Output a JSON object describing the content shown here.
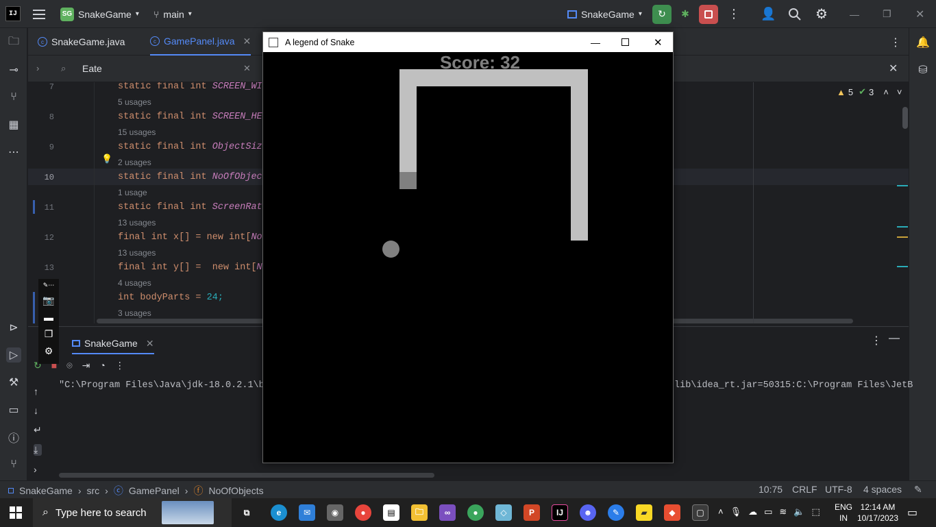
{
  "ide": {
    "project_name": "SnakeGame",
    "project_badge": "SG",
    "branch": "main",
    "run_config": "SnakeGame",
    "tabs": [
      {
        "label": "SnakeGame.java",
        "active": false
      },
      {
        "label": "GamePanel.java",
        "active": true
      }
    ],
    "search_query": "Eate",
    "inspections": {
      "warnings": "5",
      "ok": "3"
    },
    "code": [
      {
        "line": "7",
        "code": "static final int ",
        "ident": "SCREEN_WI",
        "usage": "5 usages"
      },
      {
        "line": "8",
        "code": "static final int ",
        "ident": "SCREEN_HE",
        "usage": "15 usages"
      },
      {
        "line": "9",
        "code": "static final int ",
        "ident": "ObjectSize",
        "usage": "2 usages"
      },
      {
        "line": "10",
        "code": "static final int ",
        "ident": "NoOfObject",
        "usage": "1 usage"
      },
      {
        "line": "11",
        "code": "static final int ",
        "ident": "ScreenRate",
        "usage": "13 usages"
      },
      {
        "line": "12",
        "code": "final int x[] = new int[",
        "ident": "No",
        "usage": "13 usages"
      },
      {
        "line": "13",
        "code": "final int y[] =  new int[",
        "ident": "No",
        "usage": "4 usages"
      },
      {
        "line": "",
        "code": "int bodyParts = ",
        "ident": "24;",
        "usage": "3 usages"
      }
    ],
    "run_panel": {
      "tab_label": "SnakeGame",
      "console_left": "\"C:\\Program Files\\Java\\jdk-18.0.2.1\\b",
      "console_right": "lib\\idea_rt.jar=50315:C:\\Program Files\\JetB"
    },
    "breadcrumb": [
      "SnakeGame",
      "src",
      "GamePanel",
      "NoOfObjects"
    ],
    "status": {
      "position": "10:75",
      "line_sep": "CRLF",
      "encoding": "UTF-8",
      "indent": "4 spaces"
    }
  },
  "game": {
    "window_title": "A legend of Snake",
    "score_text": "Score: 32",
    "colors": {
      "snake_body": "#c0c0c0",
      "snake_head": "#808080",
      "apple": "#808080",
      "background": "#000000"
    }
  },
  "taskbar": {
    "search_placeholder": "Type here to search",
    "language": "ENG",
    "region": "IN",
    "time": "12:14 AM",
    "date": "10/17/2023"
  }
}
